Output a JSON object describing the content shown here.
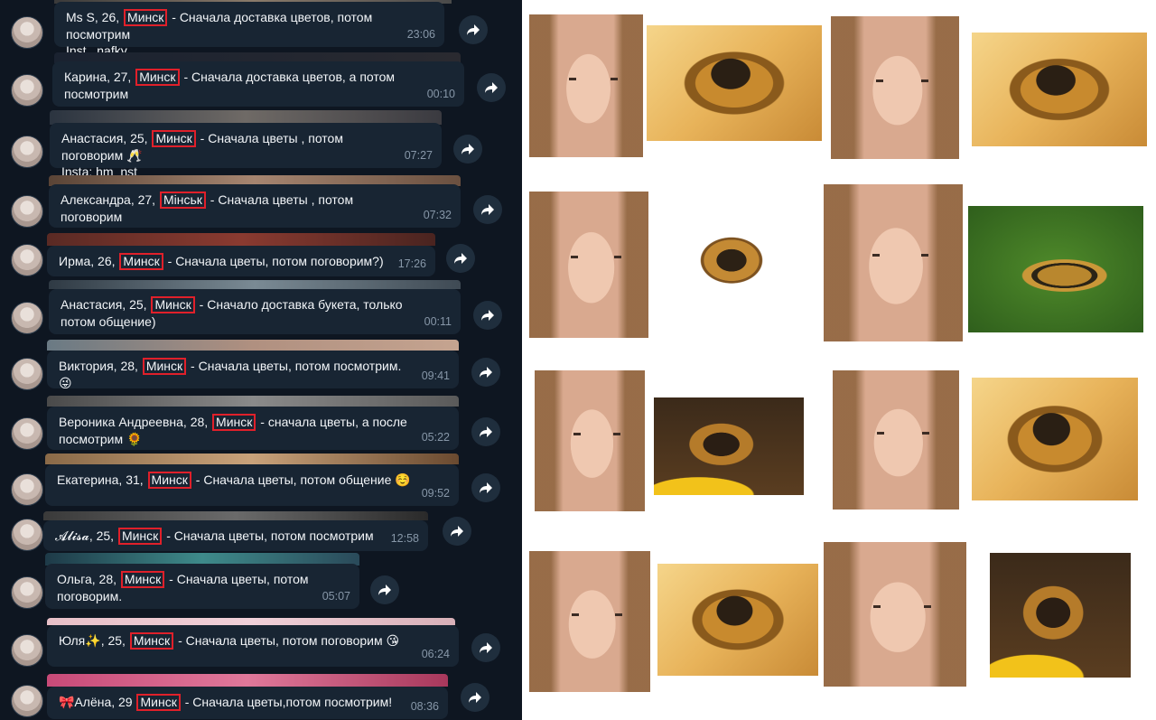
{
  "messages": [
    {
      "name": "Ms S, 26,",
      "city": "Минск",
      "text": "- Сначала доставка цветов, потом посмотрим",
      "line2": "Inst _nafky_",
      "time": "23:06",
      "emoji": ""
    },
    {
      "name": "Карина, 27,",
      "city": "Минск",
      "text": "- Сначала доставка цветов, а потом посмотрим",
      "line2": "",
      "time": "00:10",
      "emoji": ""
    },
    {
      "name": "Анастасия, 25,",
      "city": "Минск",
      "text": "- Сначала цветы , потом поговорим",
      "line2": "Insta: hm_nst",
      "time": "07:27",
      "emoji": "🥂"
    },
    {
      "name": "Александра, 27,",
      "city": "Мінськ",
      "text": "- Сначала цветы , потом поговорим",
      "line2": "",
      "time": "07:32",
      "emoji": ""
    },
    {
      "name": "Ирма, 26,",
      "city": "Минск",
      "text": "- Сначала цветы, потом поговорим?)",
      "line2": "",
      "time": "17:26",
      "emoji": ""
    },
    {
      "name": "Анастасия, 25,",
      "city": "Минск",
      "text": "- Сначало доставка букета, только потом общение)",
      "line2": "",
      "time": "00:11",
      "emoji": ""
    },
    {
      "name": "Виктория, 28,",
      "city": "Минск",
      "text": "- Сначала цветы, потом посмотрим.",
      "line2": "",
      "time": "09:41",
      "emoji": "😜"
    },
    {
      "name": "Вероника Андреевна, 28,",
      "city": "Минск",
      "text": "- сначала цветы, а после посмотрим",
      "line2": "",
      "time": "05:22",
      "emoji": "🌻"
    },
    {
      "name": "Екатерина, 31,",
      "city": "Минск",
      "text": "- Сначала цветы, потом общение",
      "line2": "",
      "time": "09:52",
      "emoji": "☺️"
    },
    {
      "name": "𝓐𝓵𝓲𝓼𝓪, 25,",
      "city": "Минск",
      "text": "- Сначала цветы, потом посмотрим",
      "line2": "",
      "time": "12:58",
      "emoji": ""
    },
    {
      "name": "Ольга, 28,",
      "city": "Минск",
      "text": "- Сначала цветы, потом поговорим.",
      "line2": "",
      "time": "05:07",
      "emoji": ""
    },
    {
      "name": "Юля✨, 25,",
      "city": "Минск",
      "text": "- Сначала цветы, потом поговорим",
      "line2": "",
      "time": "06:24",
      "emoji": "😘"
    },
    {
      "name": "🎀Алёна, 29",
      "city": "Минск",
      "text": "- Сначала цветы,потом посмотрим!",
      "line2": "",
      "time": "08:36",
      "emoji": ""
    }
  ],
  "icons": {
    "forward": "forward-arrow-icon",
    "avatar": "avatar"
  },
  "colors": {
    "highlight": "#e0202a",
    "bubble": "#182533",
    "background": "#0e1621",
    "time": "#8797a8"
  },
  "photo_grid": [
    {
      "kind": "face-photo"
    },
    {
      "kind": "bee-photo"
    },
    {
      "kind": "face-photo"
    },
    {
      "kind": "bee-photo"
    },
    {
      "kind": "face-photo"
    },
    {
      "kind": "bee-photo"
    },
    {
      "kind": "face-photo"
    },
    {
      "kind": "bee-photo"
    },
    {
      "kind": "face-photo"
    },
    {
      "kind": "bee-photo"
    },
    {
      "kind": "face-photo"
    },
    {
      "kind": "bee-photo"
    },
    {
      "kind": "face-photo"
    },
    {
      "kind": "bee-photo"
    },
    {
      "kind": "face-photo"
    },
    {
      "kind": "bee-photo"
    }
  ]
}
